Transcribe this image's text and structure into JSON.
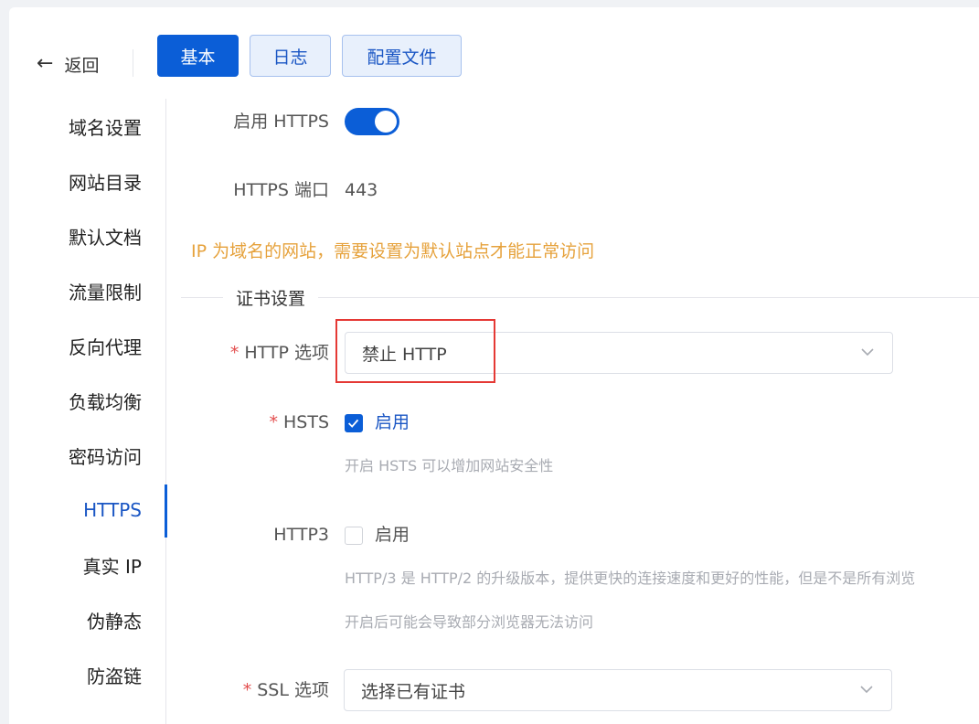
{
  "header": {
    "back_label": "返回",
    "tabs": [
      {
        "label": "基本",
        "active": true
      },
      {
        "label": "日志",
        "active": false
      },
      {
        "label": "配置文件",
        "active": false
      }
    ]
  },
  "sidebar": {
    "items": [
      {
        "label": "域名设置"
      },
      {
        "label": "网站目录"
      },
      {
        "label": "默认文档"
      },
      {
        "label": "流量限制"
      },
      {
        "label": "反向代理"
      },
      {
        "label": "负载均衡"
      },
      {
        "label": "密码访问"
      },
      {
        "label": "HTTPS",
        "active": true
      },
      {
        "label": "真实 IP"
      },
      {
        "label": "伪静态"
      },
      {
        "label": "防盗链"
      }
    ]
  },
  "form": {
    "https_enable_label": "启用 HTTPS",
    "https_enabled": true,
    "https_port_label": "HTTPS 端口",
    "https_port_value": "443",
    "ip_warning": "IP 为域名的网站，需要设置为默认站点才能正常访问",
    "cert_section_title": "证书设置",
    "http_option_label": "HTTP 选项",
    "http_option_value": "禁止 HTTP",
    "hsts_label": "HSTS",
    "hsts_checkbox_label": "启用",
    "hsts_checked": true,
    "hsts_hint": "开启 HSTS 可以增加网站安全性",
    "http3_label": "HTTP3",
    "http3_checkbox_label": "启用",
    "http3_checked": false,
    "http3_hint_1": "HTTP/3 是 HTTP/2 的升级版本，提供更快的连接速度和更好的性能，但是不是所有浏览",
    "http3_hint_2": "开启后可能会导致部分浏览器无法访问",
    "ssl_option_label": "SSL 选项",
    "ssl_option_value": "选择已有证书",
    "required_mark": "*"
  },
  "colors": {
    "primary": "#0b5ed7",
    "warning": "#e6a23c",
    "required": "#e34d4d",
    "highlight_box": "#e53935"
  }
}
